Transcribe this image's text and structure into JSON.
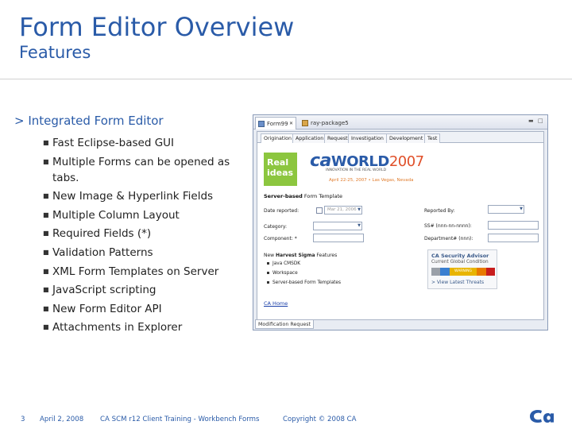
{
  "slide": {
    "title": "Form Editor Overview",
    "subtitle": "Features"
  },
  "content": {
    "main_bullet": "> Integrated Form Editor",
    "bullets": [
      "Fast Eclipse-based GUI",
      "Multiple Forms can be opened as tabs.",
      "New Image & Hyperlink Fields",
      "Multiple Column Layout",
      "Required Fields (*)",
      "Validation Patterns",
      "XML Form Templates on Server",
      "JavaScript scripting",
      "New Form Editor API",
      "Attachments in Explorer"
    ]
  },
  "screenshot": {
    "editor_tabs": [
      "Form99",
      "ray-package5"
    ],
    "form_tabs": [
      "Origination",
      "Application",
      "Request",
      "Investigation",
      "Development",
      "Test"
    ],
    "banner": {
      "real": "Real",
      "ideas": "ideas",
      "ca": "ca",
      "world": "WORLD",
      "year": "2007",
      "tagline": "INNOVATION IN THE REAL WORLD",
      "dates": "April 22-25, 2007 • Las Vegas, Nevada"
    },
    "section_bold": "Server-based",
    "section_rest": " Form Template",
    "fields": {
      "date_reported": "Date reported:",
      "date_value": "Mar 21, 2006",
      "category": "Category:",
      "component": "Component: *",
      "reported_by": "Reported By:",
      "ssn": "SS# (nnn-nn-nnnn):",
      "department": "Department# (nnn):"
    },
    "new_features": {
      "prefix": "New ",
      "bold": "Harvest Sigma",
      "suffix": " Features",
      "items": [
        "Java CMSDK",
        "Workspace",
        "Server-based Form Templates"
      ]
    },
    "advisor": {
      "title": "CA Security Advisor",
      "subtitle": "Current Global Condition",
      "status": "WARNING",
      "link": "> View Latest Threats",
      "colors": [
        "#9aa0a8",
        "#3a7fd0",
        "#e8b400",
        "#e87a00",
        "#c81e1e"
      ]
    },
    "home_link": "CA Home",
    "bottom_tab": "Modification Request"
  },
  "footer": {
    "page": "3",
    "date": "April 2, 2008",
    "course": "CA SCM r12 Client Training - Workbench Forms",
    "copyright": "Copyright © 2008 CA"
  },
  "colors": {
    "accent": "#2a5ba8"
  }
}
